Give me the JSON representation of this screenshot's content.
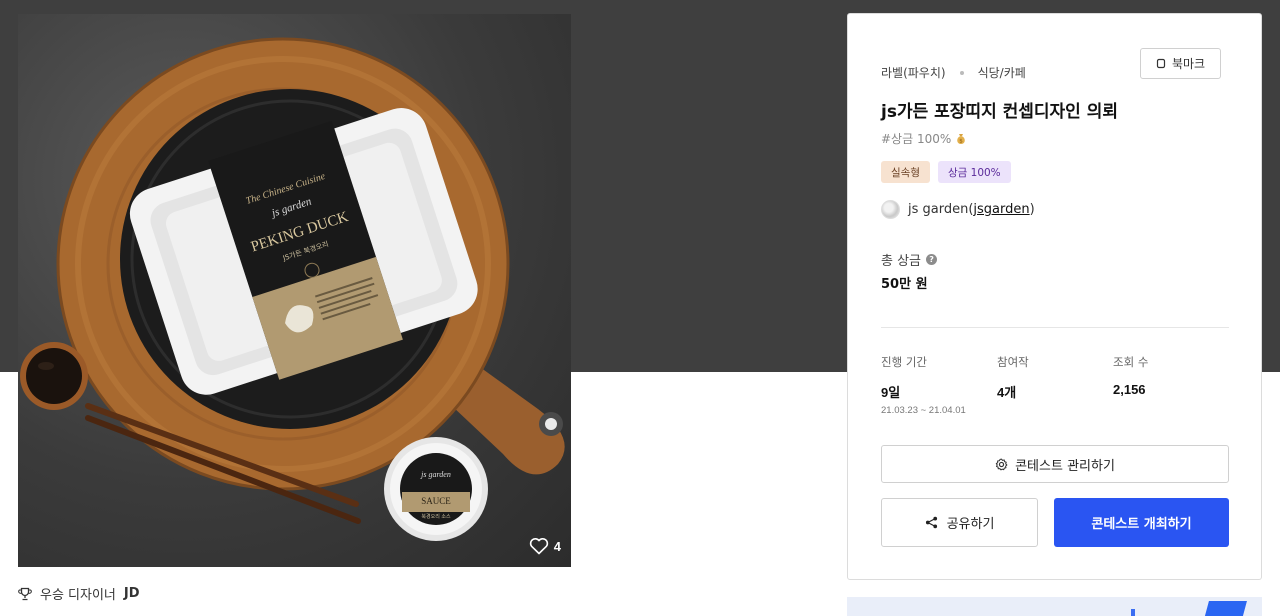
{
  "gallery": {
    "likes": "4",
    "package_brand_top": "The Chinese Cuisine",
    "package_brand": "js garden",
    "package_title": "PEKING DUCK",
    "package_subtitle": "JS가든 북경오리",
    "sauce_brand": "js garden",
    "sauce_label": "SAUCE",
    "sauce_sub": "북경오리 소스"
  },
  "winner": {
    "label": "우승 디자이너",
    "name": "JD"
  },
  "contest": {
    "category": "라벨(파우치)",
    "subcategory": "식당/카페",
    "bookmark_label": "북마크",
    "title": "js가든 포장띠지 컨셉디자인 의뢰",
    "hashtag": "#상금 100%",
    "tags": [
      "실속형",
      "상금 100%"
    ],
    "owner_name": "js garden",
    "owner_handle": "jsgarden",
    "prize_label": "총 상금",
    "prize_value": "50만 원",
    "stats": {
      "period_label": "진행 기간",
      "period_value": "9일",
      "period_range": "21.03.23  ~  21.04.01",
      "entries_label": "참여작",
      "entries_value": "4개",
      "views_label": "조회 수",
      "views_value": "2,156"
    },
    "manage_button": "콘테스트 관리하기",
    "share_button": "공유하기",
    "host_button": "콘테스트 개최하기"
  },
  "colors": {
    "primary": "#2a55f2",
    "hero_bg": "#3f3f3f",
    "tag_orange_bg": "#f7e2d0",
    "tag_purple_bg": "#ece3fb"
  }
}
